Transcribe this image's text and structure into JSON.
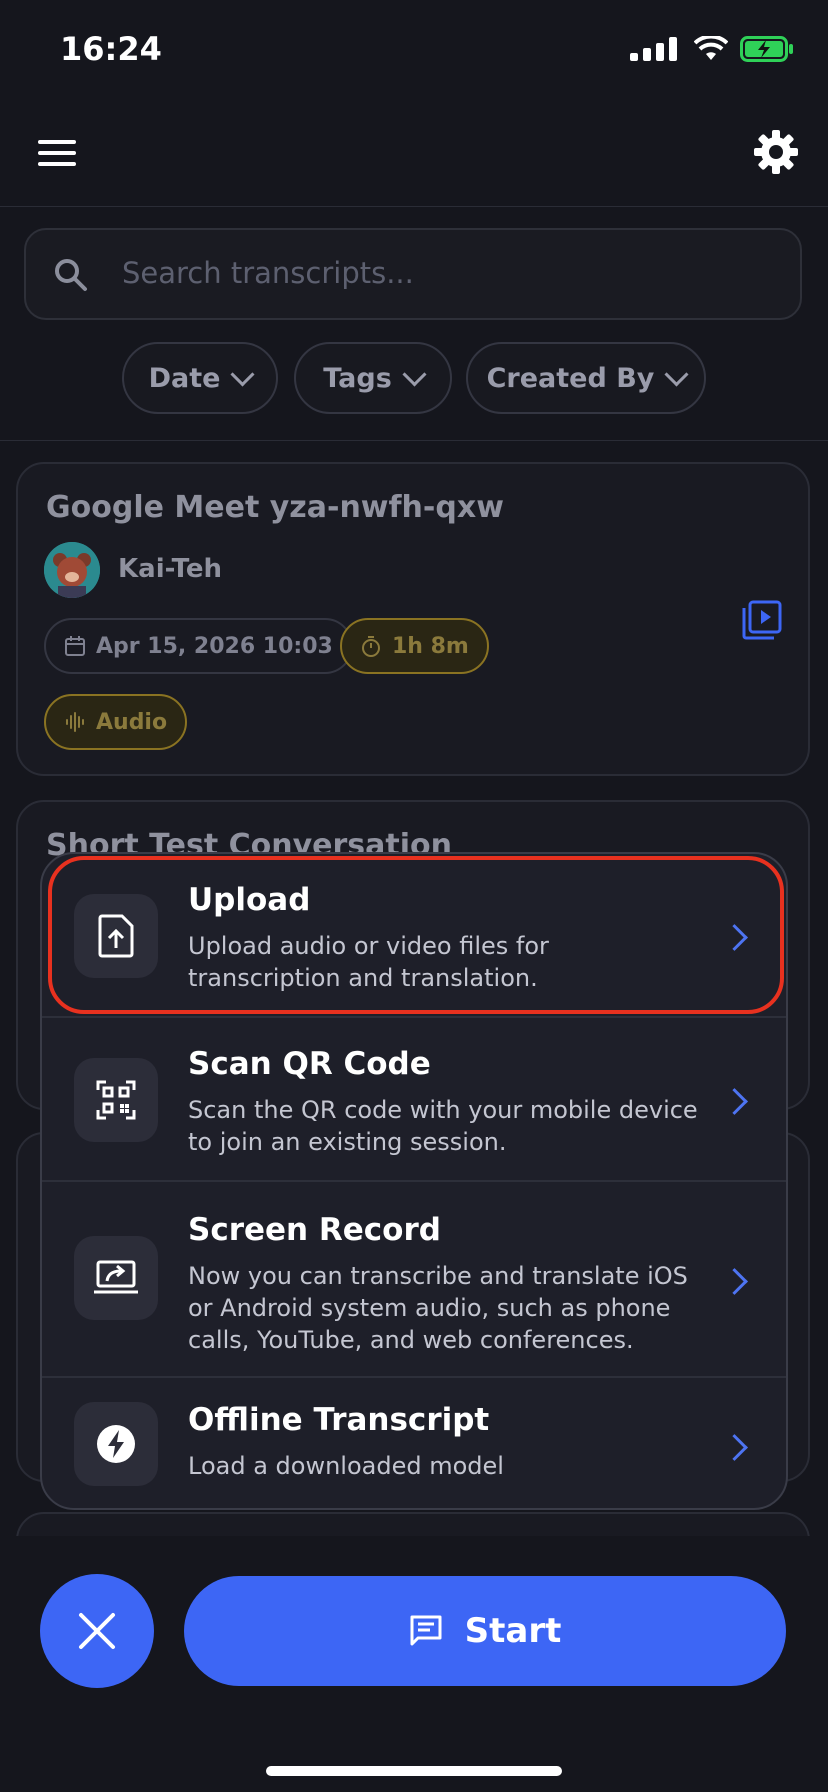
{
  "status_bar": {
    "time": "16:24"
  },
  "search": {
    "placeholder": "Search transcripts..."
  },
  "filters": [
    {
      "label": "Date"
    },
    {
      "label": "Tags"
    },
    {
      "label": "Created By"
    }
  ],
  "cards": [
    {
      "title": "Google Meet yza-nwfh-qxw",
      "author": "Kai-Teh",
      "date": "Apr 15, 2026 10:03",
      "duration": "1h 8m",
      "media_type": "Audio"
    },
    {
      "title": "Short Test Conversation"
    }
  ],
  "sheet": {
    "items": [
      {
        "title": "Upload",
        "description": "Upload audio or video files for transcription and translation.",
        "icon": "upload-file-icon"
      },
      {
        "title": "Scan QR Code",
        "description": "Scan the QR code with your mobile device to join an existing session.",
        "icon": "qr-code-icon"
      },
      {
        "title": "Screen Record",
        "description": "Now you can transcribe and translate iOS or Android system audio, such as phone calls, YouTube, and web conferences.",
        "icon": "screen-share-icon"
      },
      {
        "title": "Offline Transcript",
        "description": "Load a downloaded model",
        "icon": "lightning-icon"
      }
    ]
  },
  "bottom": {
    "start_label": "Start"
  },
  "colors": {
    "accent": "#3d66f5",
    "highlight": "#e8311f",
    "gold": "#8a7322"
  }
}
